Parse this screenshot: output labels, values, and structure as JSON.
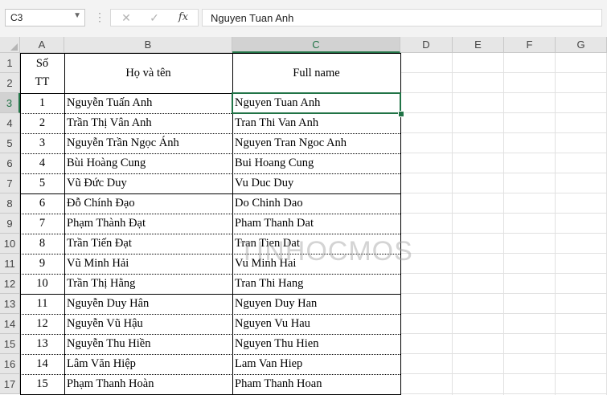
{
  "formula_bar": {
    "name_box": "C3",
    "cancel_icon": "✕",
    "enter_icon": "✓",
    "fx_label": "fx",
    "formula_value": "Nguyen Tuan Anh"
  },
  "columns": [
    "A",
    "B",
    "C",
    "D",
    "E",
    "F",
    "G"
  ],
  "rows": [
    "1",
    "2",
    "3",
    "4",
    "5",
    "6",
    "7",
    "8",
    "9",
    "10",
    "11",
    "12",
    "13",
    "14",
    "15",
    "16",
    "17"
  ],
  "header": {
    "stt_line1": "Số",
    "stt_line2": "TT",
    "name": "Họ và tên",
    "full_name": "Full name"
  },
  "table": [
    {
      "stt": "1",
      "name": "Nguyễn Tuấn Anh",
      "full": "Nguyen Tuan Anh"
    },
    {
      "stt": "2",
      "name": "Trần Thị Vân Anh",
      "full": "Tran Thi Van Anh"
    },
    {
      "stt": "3",
      "name": "Nguyễn Trần Ngọc Ánh",
      "full": "Nguyen Tran Ngoc Anh"
    },
    {
      "stt": "4",
      "name": "Bùi Hoàng Cung",
      "full": "Bui Hoang Cung"
    },
    {
      "stt": "5",
      "name": "Vũ Đức Duy",
      "full": "Vu Duc Duy"
    },
    {
      "stt": "6",
      "name": "Đỗ Chính Đạo",
      "full": "Do Chinh Dao"
    },
    {
      "stt": "7",
      "name": "Phạm Thành Đạt",
      "full": "Pham Thanh Dat"
    },
    {
      "stt": "8",
      "name": "Trần Tiến Đạt",
      "full": "Tran Tien Dat"
    },
    {
      "stt": "9",
      "name": "Vũ Minh Hải",
      "full": "Vu Minh Hai"
    },
    {
      "stt": "10",
      "name": "Trần Thị Hằng",
      "full": "Tran Thi Hang"
    },
    {
      "stt": "11",
      "name": "Nguyễn Duy Hân",
      "full": "Nguyen Duy Han"
    },
    {
      "stt": "12",
      "name": "Nguyễn Vũ Hậu",
      "full": "Nguyen Vu Hau"
    },
    {
      "stt": "13",
      "name": "Nguyễn Thu Hiền",
      "full": "Nguyen Thu Hien"
    },
    {
      "stt": "14",
      "name": "Lâm Văn Hiệp",
      "full": "Lam Van Hiep"
    },
    {
      "stt": "15",
      "name": "Phạm Thanh Hoàn",
      "full": "Pham Thanh Hoan"
    }
  ],
  "watermark": "TINHOCMOS",
  "colors": {
    "accent": "#217346",
    "header_bg": "#e6e6e6",
    "grid": "#e1e1e1"
  }
}
